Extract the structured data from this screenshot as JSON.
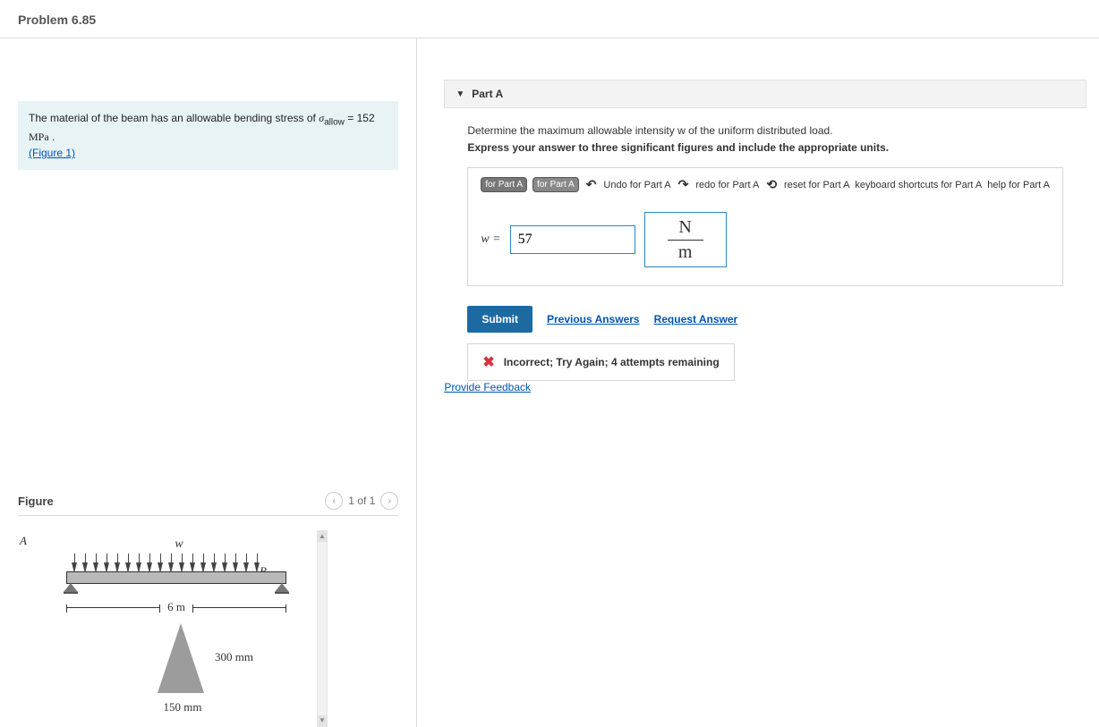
{
  "problem_title": "Problem 6.85",
  "intro": {
    "text_before_sigma": "The material of the beam has an allowable bending stress of ",
    "sigma": "σ",
    "sigma_sub": "allow",
    "equals": " = 152 ",
    "unit": "MPa",
    "period": " .",
    "figure_link": "(Figure 1)"
  },
  "figure": {
    "title": "Figure",
    "counter": "1 of 1",
    "w_label": "w",
    "label_A": "A",
    "label_B": "B",
    "span": "6 m",
    "height": "300 mm",
    "base": "150 mm"
  },
  "partA": {
    "header": "Part A",
    "question_line": "Determine the maximum allowable intensity w of the uniform distributed load.",
    "instruction": "Express your answer to three significant figures and include the appropriate units.",
    "toolbar": {
      "chip1": "for Part A",
      "chip2": "for Part A",
      "undo": "Undo for Part A",
      "redo": "redo for Part A",
      "reset": "reset for Part A",
      "keyboard": "keyboard shortcuts for Part A",
      "help": "help for Part A"
    },
    "w_eq": "w = ",
    "value": "57",
    "unit_num": "N",
    "unit_den": "m",
    "submit": "Submit",
    "prev_answers": "Previous Answers",
    "request_answer": "Request Answer",
    "feedback": "Incorrect; Try Again; 4 attempts remaining"
  },
  "provide_feedback": "Provide Feedback"
}
